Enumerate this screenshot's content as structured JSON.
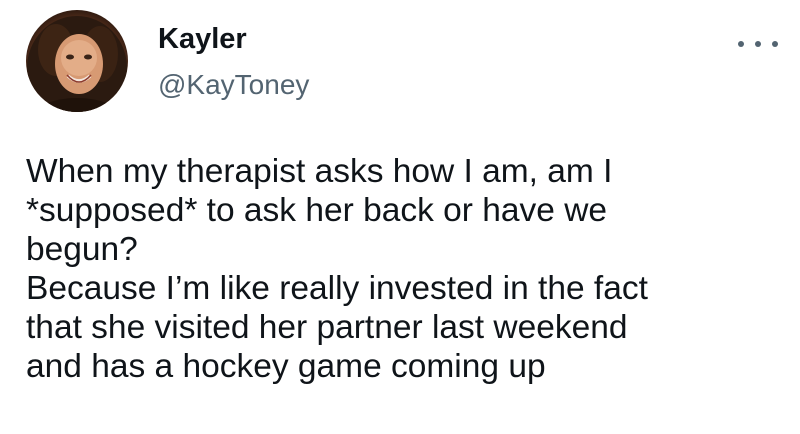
{
  "tweet": {
    "author": {
      "name": "Kayler",
      "handle": "@KayToney",
      "avatar_icon": "profile-photo"
    },
    "more_icon": "more-horizontal-icon",
    "body": {
      "paragraph_1_line_1": "When my therapist asks how I am, am I",
      "paragraph_1_line_2": "*supposed* to ask her back or have we",
      "paragraph_1_line_3": "begun?",
      "paragraph_2_line_1": "Because I’m like really invested in the fact",
      "paragraph_2_line_2": "that she visited her partner last weekend",
      "paragraph_2_line_3": "and has a hockey game coming up"
    }
  },
  "colors": {
    "text": "#0f1419",
    "secondary_text": "#536471",
    "background": "#ffffff"
  }
}
